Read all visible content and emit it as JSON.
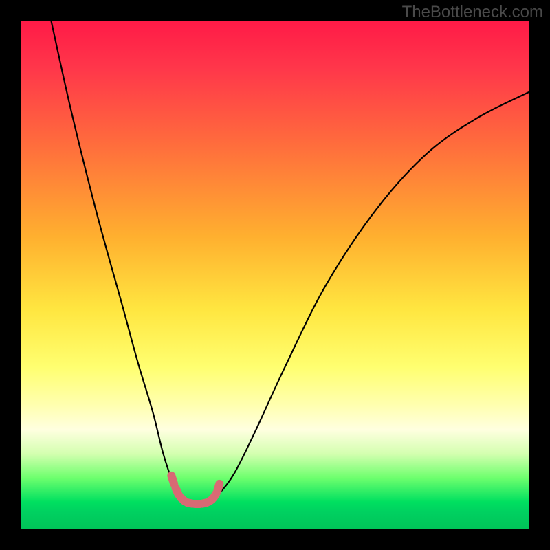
{
  "watermark": "TheBottleneck.com",
  "colors": {
    "frame": "#000000",
    "curve_stroke": "#000000",
    "marker_stroke": "#d86a74",
    "gradient_top": "#ff1a47",
    "gradient_bottom": "#00c458"
  },
  "chart_data": {
    "type": "line",
    "title": "",
    "xlabel": "",
    "ylabel": "",
    "xlim": [
      0,
      100
    ],
    "ylim": [
      0,
      100
    ],
    "series": [
      {
        "name": "bottleneck-curve",
        "x_percent": [
          6,
          10,
          15,
          20,
          23,
          26,
          28,
          30,
          31.5,
          33,
          35,
          37,
          39,
          42,
          46,
          52,
          60,
          70,
          80,
          90,
          100
        ],
        "y_percent": [
          100,
          82,
          62,
          44,
          33,
          23,
          15,
          9,
          6,
          5,
          5,
          5.3,
          7,
          11,
          19,
          32,
          48,
          63,
          74,
          81,
          86
        ]
      }
    ],
    "markers": {
      "name": "highlight-segment",
      "x_percent": [
        29.5,
        30.3,
        31.2,
        32.5,
        34.0,
        35.5,
        36.8,
        37.8,
        38.6,
        39.2
      ],
      "y_percent": [
        11.0,
        8.5,
        6.5,
        5.3,
        5.0,
        5.0,
        5.3,
        6.0,
        7.3,
        9.3
      ]
    },
    "notes": "y_percent is plotted downward from the top of the plot; 0 = top edge, 100 = bottom edge. The curve is a V-shaped bottleneck profile dipping to ~5% near x≈34%."
  }
}
